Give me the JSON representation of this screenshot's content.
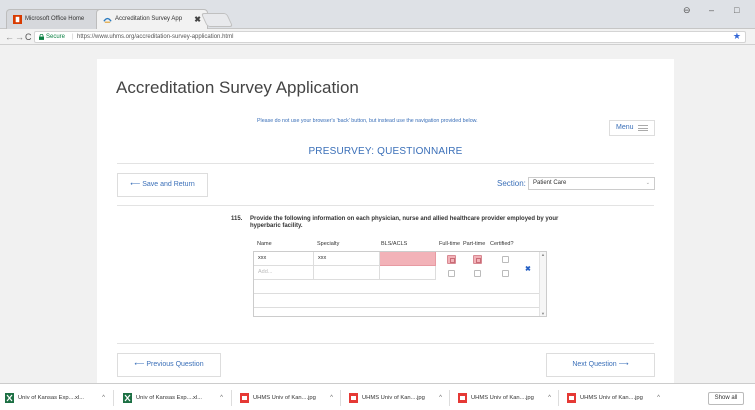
{
  "browser": {
    "tabs": [
      {
        "title": "Microsoft Office Home",
        "active": false,
        "close": "✖"
      },
      {
        "title": "Accreditation Survey App",
        "active": true,
        "close": "✖"
      }
    ],
    "secure_label": "Secure",
    "separator": "|",
    "url": "https://www.uhms.org/accreditation-survey-application.html",
    "window_controls": {
      "account": "⊖",
      "minimize": "–",
      "maximize": "□"
    }
  },
  "page": {
    "title": "Accreditation Survey Application",
    "notice": "Please do not use your browser's 'back' button, but instead use the navigation provided below.",
    "menu_label": "Menu",
    "subtitle": "PRESURVEY: QUESTIONNAIRE",
    "save_return_label": "⟵  Save and Return",
    "section_label": "Section:",
    "section_value": "Patient Care",
    "question": {
      "number": "115.",
      "text": "Provide the following information on each physician, nurse and allied healthcare provider employed by your hyperbaric facility."
    },
    "grid": {
      "headers": [
        "Name",
        "Specialty",
        "BLS/ACLS",
        "Full-time",
        "Part-time",
        "Certified?"
      ],
      "rows": [
        {
          "name": "xxx",
          "specialty": "xxx",
          "bls": ""
        },
        {
          "name_placeholder": "Add..."
        }
      ]
    },
    "prev_label": "⟵  Previous Question",
    "next_label": "Next Question  ⟶"
  },
  "downloads": {
    "items": [
      {
        "name": "Univ of Kansas Exp....xl...",
        "type": "excel"
      },
      {
        "name": "Univ of Kansas Exp....xl...",
        "type": "excel"
      },
      {
        "name": "UHMS Univ of Kan....jpg",
        "type": "image"
      },
      {
        "name": "UHMS Univ of Kan....jpg",
        "type": "image"
      },
      {
        "name": "UHMS Univ of Kan....jpg",
        "type": "image"
      },
      {
        "name": "UHMS Univ of Kan....jpg",
        "type": "image"
      }
    ],
    "caret": "^",
    "show_all": "Show all"
  },
  "colors": {
    "accent": "#3a6fb8",
    "invalid": "#f2b2b8",
    "secure": "#0b8043"
  }
}
